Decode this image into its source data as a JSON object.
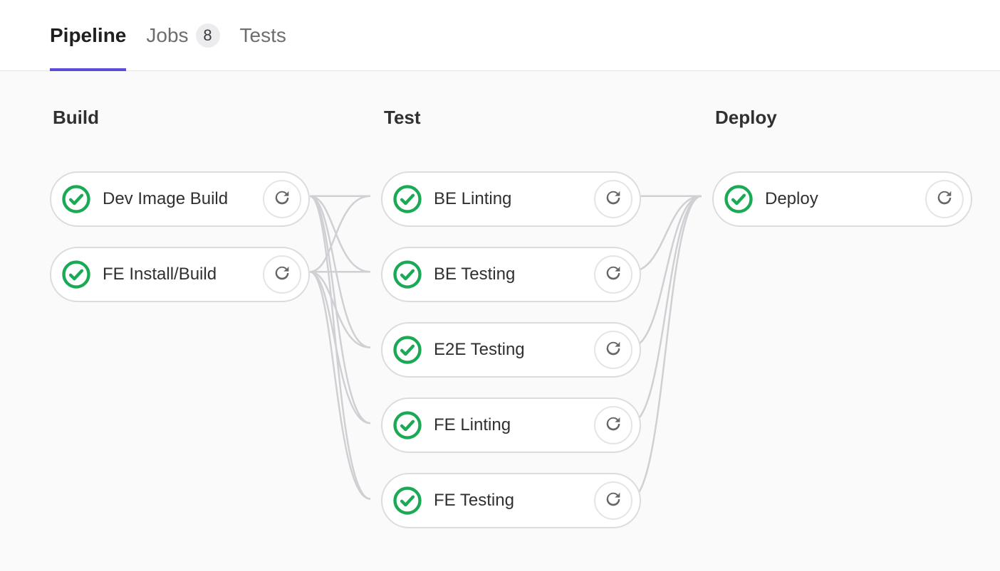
{
  "tabs": {
    "pipeline": "Pipeline",
    "jobs": "Jobs",
    "jobs_count": "8",
    "tests": "Tests"
  },
  "stages": [
    {
      "title": "Build",
      "jobs": [
        {
          "name": "Dev Image Build",
          "status": "success"
        },
        {
          "name": "FE Install/Build",
          "status": "success"
        }
      ]
    },
    {
      "title": "Test",
      "jobs": [
        {
          "name": "BE Linting",
          "status": "success"
        },
        {
          "name": "BE Testing",
          "status": "success"
        },
        {
          "name": "E2E Testing",
          "status": "success"
        },
        {
          "name": "FE Linting",
          "status": "success"
        },
        {
          "name": "FE Testing",
          "status": "success"
        }
      ]
    },
    {
      "title": "Deploy",
      "jobs": [
        {
          "name": "Deploy",
          "status": "success"
        }
      ]
    }
  ]
}
